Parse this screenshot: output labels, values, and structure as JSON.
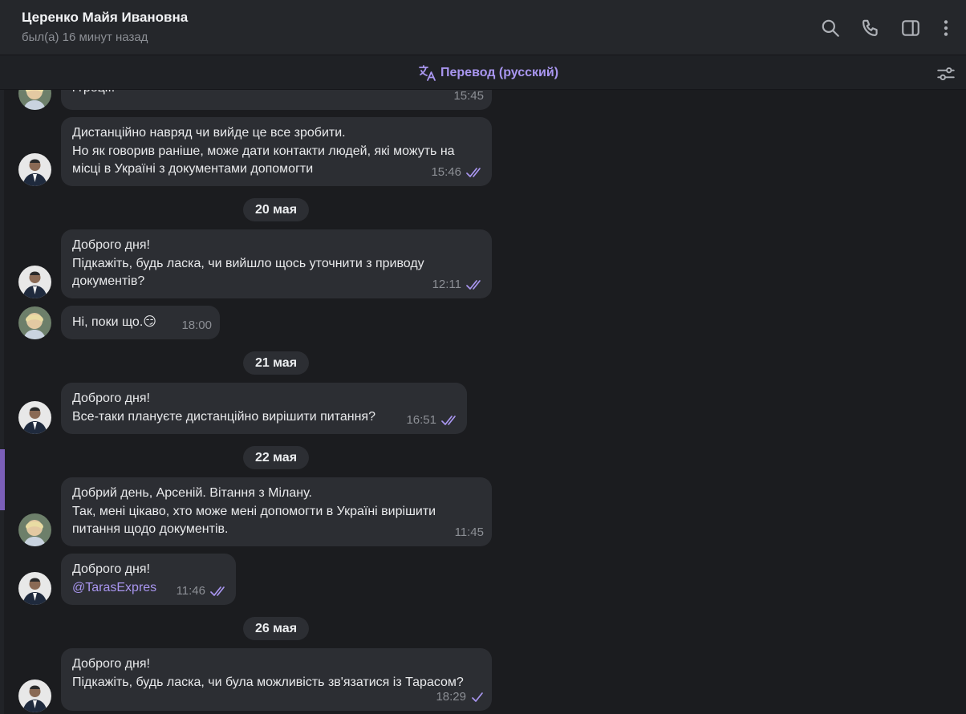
{
  "header": {
    "contact_name": "Церенко Майя Ивановна",
    "status": "был(а) 16 минут назад",
    "icons": [
      "search-icon",
      "phone-icon",
      "sidebar-toggle-icon",
      "more-vertical-icon"
    ]
  },
  "translate_bar": {
    "label": "Перевод (русский)",
    "accent_color": "#a996f0"
  },
  "colors": {
    "background": "#1b1c1f",
    "bubble": "#2c2e33",
    "header": "#25272b",
    "accent": "#a996f0"
  },
  "messages": [
    {
      "sender": "contact",
      "text": "і греції.",
      "time": "15:45",
      "ticks": "none"
    },
    {
      "sender": "self",
      "text": "Дистанційно  навряд чи вийде це все зробити.\nНо як говорив раніше, може дати контакти людей, які можуть на місці в Україні з документами допомогти",
      "time": "15:46",
      "ticks": "double"
    },
    {
      "date": "20 мая"
    },
    {
      "sender": "self",
      "text": "Доброго дня!\nПідкажіть, будь ласка, чи вийшло щось уточнити з приводу документів?",
      "time": "12:11",
      "ticks": "double"
    },
    {
      "sender": "contact",
      "text": "Ні, поки що.",
      "emoji": "😏",
      "time": "18:00",
      "ticks": "none"
    },
    {
      "date": "21 мая"
    },
    {
      "sender": "self",
      "text": "Доброго дня!\nВсе-таки плануєте дистанційно вирішити питання?",
      "time": "16:51",
      "ticks": "double"
    },
    {
      "date": "22 мая"
    },
    {
      "sender": "contact",
      "text": "Добрий день, Арсеній. Вітання з Мілану.\nТак, мені цікаво, хто може мені допомогти в Україні вирішити питання щодо документів.",
      "time": "11:45",
      "ticks": "none"
    },
    {
      "sender": "self",
      "text": "Доброго дня!",
      "mention": "@TarasExpres",
      "time": "11:46",
      "ticks": "double"
    },
    {
      "date": "26 мая"
    },
    {
      "sender": "self",
      "text": "Доброго дня!\nПідкажіть, будь ласка, чи була можливість зв'язатися із Тарасом?",
      "time": "18:29",
      "ticks": "single"
    }
  ]
}
